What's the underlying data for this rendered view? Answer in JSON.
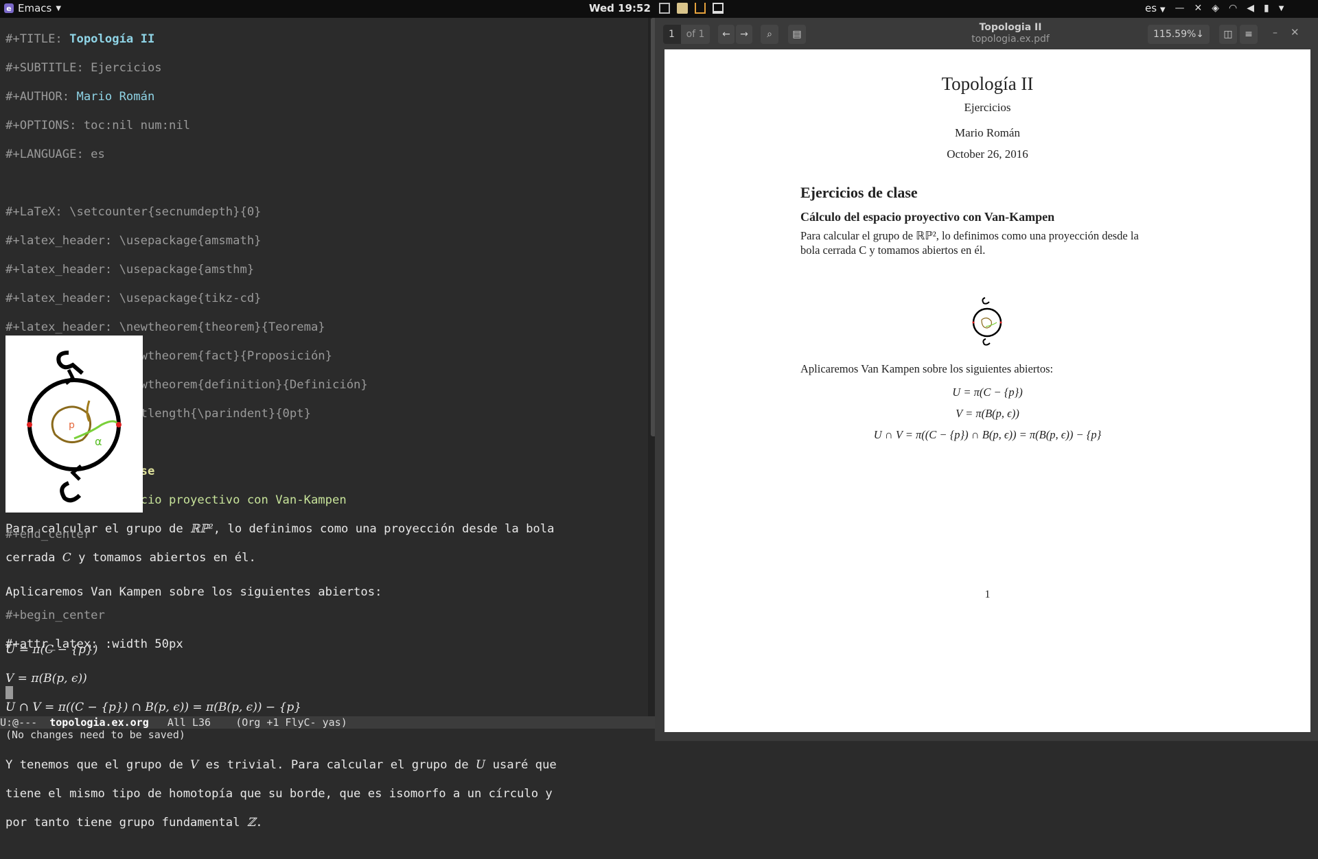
{
  "topbar": {
    "app_name": "Emacs",
    "clock": "Wed 19:52",
    "keyboard_layout": "es",
    "tray_icons": [
      "screenshot-icon",
      "notes-icon",
      "bag-icon",
      "display-icon"
    ],
    "system_icons": [
      "network-icon",
      "wifi-icon",
      "volume-icon",
      "battery-icon"
    ]
  },
  "emacs": {
    "lines": {
      "title_kw": "#+TITLE: ",
      "title_val": "Topología II",
      "subtitle": "#+SUBTITLE: Ejercicios",
      "author_kw": "#+AUTHOR: ",
      "author_val": "Mario Román",
      "options": "#+OPTIONS: toc:nil num:nil",
      "language": "#+LANGUAGE: es",
      "latex_setcounter": "#+LaTeX: \\setcounter{secnumdepth}{0}",
      "h_amsmath": "#+latex_header: \\usepackage{amsmath}",
      "h_amsthm": "#+latex_header: \\usepackage{amsthm}",
      "h_tikzcd": "#+latex_header: \\usepackage{tikz-cd}",
      "h_theorem": "#+latex_header: \\newtheorem{theorem}{Teorema}",
      "h_fact": "#+latex_header: \\newtheorem{fact}{Proposición}",
      "h_definition": "#+latex_header: \\newtheorem{definition}{Definición}",
      "h_parindent": "#+latex_header: \\setlength{\\parindent}{0pt}",
      "heading1": "* Ejercicios de clase",
      "heading2": "** Cálculo del espacio proyectivo con Van-Kampen",
      "para1_a": "Para calcular el grupo de ",
      "para1_rp": "ℝℙ²",
      "para1_b": ", lo definimos como una proyección desde la bola",
      "para2_a": "cerrada ",
      "para2_c": "C",
      "para2_b": " y tomamos abiertos en él.",
      "begin_center": "#+begin_center",
      "attr_latex": "#+attr_latex: :width 50px",
      "end_center": "#+end_center",
      "para3": "Aplicaremos Van Kampen sobre los siguientes abiertos:",
      "eq1": "U = π(C − {p})",
      "eq2": "V = π(B(p, ϵ))",
      "eq3": "U ∩ V = π((C − {p}) ∩ B(p, ϵ)) = π(B(p, ϵ)) − {p}",
      "para4_a": "Y tenemos que el grupo de ",
      "para4_v": "V",
      "para4_b": " es trivial. Para calcular el grupo de ",
      "para4_u": "U",
      "para4_c": " usaré que",
      "para5": "tiene el mismo tipo de homotopía que su borde, que es isomorfo a un círculo y",
      "para6_a": "por tanto tiene grupo fundamental ",
      "para6_z": "ℤ",
      "para6_b": "."
    },
    "modeline": {
      "status": "U:@---  ",
      "buffer": "topologia.ex.org",
      "position": "   All L36    ",
      "modes": "(Org +1 FlyC- yas)"
    },
    "minibuffer": "(No changes need to be saved)"
  },
  "pdf": {
    "page_input": "1",
    "page_of": "of 1",
    "window_title": "Topologia II",
    "file_name": "topologia.ex.pdf",
    "zoom": "115.59%",
    "page": {
      "title": "Topología II",
      "subtitle": "Ejercicios",
      "author": "Mario Román",
      "date": "October 26, 2016",
      "section": "Ejercicios de clase",
      "subsection": "Cálculo del espacio proyectivo con Van-Kampen",
      "para_line1": "Para calcular el grupo de ℝℙ², lo definimos como una proyección desde la",
      "para_line2": "bola cerrada C y tomamos abiertos en él.",
      "para2": "Aplicaremos Van Kampen sobre los siguientes abiertos:",
      "eq1": "U = π(C − {p})",
      "eq2": "V = π(B(p, ϵ))",
      "eq3": "U ∩ V = π((C − {p}) ∩ B(p, ϵ)) = π(B(p, ϵ)) − {p}",
      "page_number": "1"
    }
  }
}
